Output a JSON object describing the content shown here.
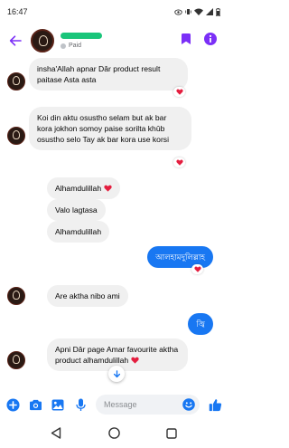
{
  "status_bar": {
    "time": "16:47"
  },
  "header": {
    "paid_label": "Paid"
  },
  "messages": [
    {
      "text": "insha'Allah apnar Dâr product result paitase Asta asta"
    },
    {
      "text": "Koi din aktu osustho selam but ak bar kora jokhon somoy paise sorilta khûb osustho selo Tay ak bar kora use korsi"
    },
    {
      "text": "Alhamdulillah"
    },
    {
      "text": "Valo lagtasa"
    },
    {
      "text": "Alhamdulillah"
    },
    {
      "text": "আলহামদুলিল্লাহ"
    },
    {
      "text": "Are aktha nibo ami"
    },
    {
      "text": "জ্বি"
    },
    {
      "text": "Apni Dâr page Amar favourite aktha product alhamdulillah"
    }
  ],
  "composer": {
    "placeholder": "Message"
  },
  "colors": {
    "accent": "#1877f2",
    "header_icons": "#7b2ff7",
    "heart": "#e41e3f"
  },
  "icons": [
    "back-arrow-icon",
    "tag-icon",
    "info-icon",
    "plus-icon",
    "camera-icon",
    "gallery-icon",
    "mic-icon",
    "emoji-icon",
    "thumbs-up-icon",
    "heart-icon",
    "chevron-down-icon"
  ]
}
